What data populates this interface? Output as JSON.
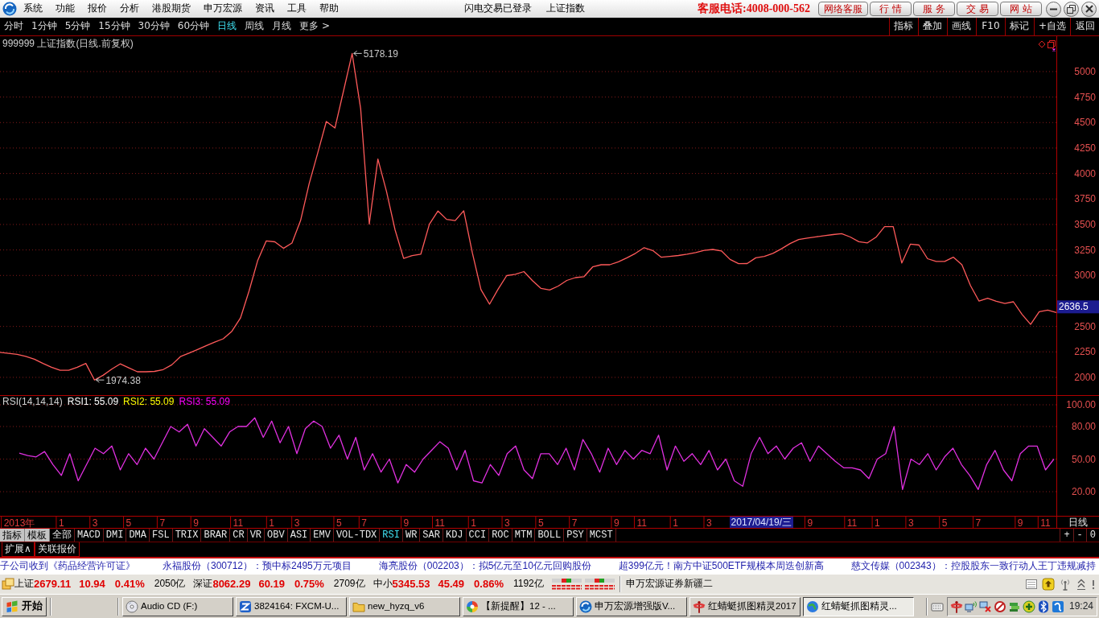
{
  "title_bar": {
    "menu": [
      "系统",
      "功能",
      "报价",
      "分析",
      "港股期货",
      "申万宏源",
      "资讯",
      "工具",
      "帮助"
    ],
    "login_status": "闪电交易已登录",
    "window_title": "上证指数",
    "hotline": "客服电话:4008-000-562",
    "service_buttons": [
      "网络客服",
      "行 情",
      "服 务",
      "交 易",
      "网 站"
    ]
  },
  "period_bar": {
    "periods": [
      {
        "label": "分时",
        "selected": false
      },
      {
        "label": "1分钟",
        "selected": false
      },
      {
        "label": "5分钟",
        "selected": false
      },
      {
        "label": "15分钟",
        "selected": false
      },
      {
        "label": "30分钟",
        "selected": false
      },
      {
        "label": "60分钟",
        "selected": false
      },
      {
        "label": "日线",
        "selected": true
      },
      {
        "label": "周线",
        "selected": false
      },
      {
        "label": "月线",
        "selected": false
      },
      {
        "label": "更多 >",
        "selected": false
      }
    ],
    "tools": [
      "指标",
      "叠加",
      "画线",
      "F10",
      "标记",
      "+自选",
      "返回"
    ]
  },
  "price_chart": {
    "chart_data": {
      "type": "line",
      "title": "999999 上证指数(日线.前复权)",
      "grid": true,
      "ylim": [
        1826,
        5347
      ],
      "yticks": [
        2000,
        2250,
        2500,
        3000,
        3250,
        3500,
        3750,
        4000,
        4250,
        4500,
        4750,
        5000
      ],
      "categories": [
        null,
        null,
        null,
        null,
        null,
        null,
        null,
        null,
        null,
        null,
        null,
        null,
        null,
        null,
        null,
        null,
        null,
        null,
        null,
        null,
        null,
        null,
        null,
        null,
        null,
        null,
        null,
        null,
        null,
        null,
        null,
        null,
        null,
        null,
        null,
        null,
        null,
        null,
        null,
        null,
        null,
        null,
        null,
        null,
        null,
        null,
        null,
        null,
        null,
        null,
        null,
        null,
        null,
        null,
        null,
        null,
        null,
        null,
        null,
        null,
        null,
        null,
        null,
        null,
        null,
        null,
        null,
        null,
        null,
        null,
        null,
        null,
        null,
        null,
        null,
        null,
        null,
        null,
        null,
        null,
        null,
        null,
        null,
        null,
        null,
        null,
        null,
        null,
        null,
        null,
        null,
        null,
        null,
        null,
        null,
        null,
        null,
        null,
        null,
        null,
        null,
        null,
        null,
        null,
        null,
        null,
        null,
        null,
        null,
        null,
        null,
        null,
        null,
        null,
        null,
        null,
        null,
        null,
        null,
        null,
        null,
        null,
        null,
        null
      ],
      "series": [
        {
          "color": "#ff5a5a",
          "values": [
            2245,
            2236,
            2226,
            2206,
            2179,
            2136,
            2099,
            2070,
            2070,
            2099,
            2137,
            1974.38,
            2020,
            2080,
            2132,
            2094,
            2055,
            2055,
            2059,
            2076,
            2123,
            2203,
            2237,
            2273,
            2310,
            2346,
            2379,
            2452,
            2582,
            2848,
            3144,
            3339,
            3330,
            3266,
            3318,
            3538,
            3901,
            4203,
            4510,
            4446,
            4810,
            5178.19,
            4635,
            3504,
            4142,
            3824,
            3448,
            3167,
            3195,
            3209,
            3503,
            3632,
            3550,
            3538,
            3635,
            3222,
            2862,
            2718,
            2865,
            2998,
            3011,
            3038,
            2949,
            2873,
            2857,
            2896,
            2951,
            2979,
            2988,
            3084,
            3105,
            3105,
            3134,
            3174,
            3217,
            3272,
            3245,
            3178,
            3186,
            3196,
            3209,
            3225,
            3246,
            3255,
            3241,
            3157,
            3115,
            3117,
            3173,
            3187,
            3216,
            3262,
            3313,
            3353,
            3366,
            3379,
            3391,
            3401,
            3410,
            3377,
            3331,
            3320,
            3375,
            3478,
            3478,
            3122,
            3307,
            3298,
            3164,
            3137,
            3137,
            3179,
            3106,
            2900,
            2748,
            2776,
            2747,
            2725,
            2742,
            2619,
            2520,
            2644,
            2660,
            2636.5
          ]
        }
      ],
      "annotations": [
        "5178.19",
        "1974.38",
        "2636.5"
      ]
    }
  },
  "rsi_panel": {
    "legend": [
      {
        "label": "RSI1: 55.09",
        "color": "#ffffff"
      },
      {
        "label": "RSI2: 55.09",
        "color": "#ffff00"
      },
      {
        "label": "RSI3: 55.09",
        "color": "#ff00ff"
      }
    ],
    "axis_period": "日线",
    "chart_data": {
      "type": "line",
      "title": "RSI(14,14,14)",
      "grid": true,
      "ylim": [
        -2.2,
        108.9
      ],
      "yticks": [
        {
          "value": 20,
          "label": "20.00"
        },
        {
          "value": 50,
          "label": "50.00"
        },
        {
          "value": 80,
          "label": "80.00"
        },
        {
          "value": 100,
          "label": "100.00"
        }
      ],
      "categories": [
        "2013年",
        null,
        null,
        null,
        null,
        "1",
        null,
        null,
        null,
        "3",
        null,
        null,
        null,
        "5",
        null,
        null,
        null,
        "7",
        null,
        null,
        null,
        "9",
        null,
        null,
        null,
        null,
        "11",
        null,
        null,
        null,
        "1",
        null,
        null,
        "3",
        null,
        null,
        null,
        null,
        "5",
        null,
        null,
        "7",
        null,
        null,
        null,
        null,
        "9",
        null,
        null,
        null,
        "11",
        null,
        null,
        null,
        "1",
        null,
        null,
        null,
        "3",
        null,
        null,
        null,
        "5",
        null,
        null,
        null,
        "7",
        null,
        null,
        null,
        null,
        "9",
        null,
        null,
        "11",
        null,
        null,
        null,
        "1",
        null,
        null,
        null,
        "3",
        null,
        null,
        null,
        null,
        null,
        null,
        null,
        null,
        null,
        null,
        null,
        "9",
        null,
        null,
        null,
        null,
        "11",
        null,
        null,
        "1",
        null,
        null,
        null,
        "3",
        null,
        null,
        null,
        "5",
        null,
        null,
        null,
        "7",
        null,
        null,
        null,
        null,
        "9",
        null,
        null,
        "11",
        null
      ],
      "series": [
        {
          "color": "#e030e0",
          "values": [
            55.4,
            53.2,
            52,
            57,
            45,
            35,
            55,
            30,
            45,
            60,
            55,
            62,
            40,
            55,
            45,
            60,
            50,
            65,
            80,
            75,
            82,
            62,
            78,
            70,
            62,
            75,
            80,
            80,
            88,
            70,
            85,
            65,
            80,
            55,
            78,
            85,
            80,
            60,
            72,
            50,
            70,
            40,
            55,
            38,
            50,
            28,
            45,
            38,
            50,
            58,
            66,
            60,
            40,
            58,
            30,
            28,
            45,
            35,
            55,
            62,
            40,
            32,
            55,
            55,
            45,
            60,
            40,
            68,
            55,
            38,
            60,
            45,
            58,
            50,
            58,
            55,
            72,
            40,
            62,
            48,
            55,
            45,
            58,
            40,
            50,
            30,
            25,
            55,
            70,
            55,
            62,
            50,
            60,
            65,
            48,
            62,
            55,
            48,
            42,
            42,
            40,
            32,
            50,
            55,
            80,
            22,
            50,
            45,
            55,
            40,
            52,
            60,
            45,
            35,
            22,
            45,
            58,
            40,
            30,
            55,
            62,
            62,
            40,
            50
          ]
        }
      ],
      "annotations": [
        "2017/04/19/三"
      ]
    }
  },
  "indicator_bar": {
    "buttons": [
      "指标",
      "模板"
    ],
    "tabs": [
      {
        "label": "全部",
        "selected": false
      },
      {
        "label": "MACD",
        "selected": false
      },
      {
        "label": "DMI",
        "selected": false
      },
      {
        "label": "DMA",
        "selected": false
      },
      {
        "label": "FSL",
        "selected": false
      },
      {
        "label": "TRIX",
        "selected": false
      },
      {
        "label": "BRAR",
        "selected": false
      },
      {
        "label": "CR",
        "selected": false
      },
      {
        "label": "VR",
        "selected": false
      },
      {
        "label": "OBV",
        "selected": false
      },
      {
        "label": "ASI",
        "selected": false
      },
      {
        "label": "EMV",
        "selected": false
      },
      {
        "label": "VOL-TDX",
        "selected": false
      },
      {
        "label": "RSI",
        "selected": true
      },
      {
        "label": "WR",
        "selected": false
      },
      {
        "label": "SAR",
        "selected": false
      },
      {
        "label": "KDJ",
        "selected": false
      },
      {
        "label": "CCI",
        "selected": false
      },
      {
        "label": "ROC",
        "selected": false
      },
      {
        "label": "MTM",
        "selected": false
      },
      {
        "label": "BOLL",
        "selected": false
      },
      {
        "label": "PSY",
        "selected": false
      },
      {
        "label": "MCST",
        "selected": false
      }
    ],
    "zoom_buttons": [
      "+",
      "-",
      "0"
    ]
  },
  "panel_tabs": [
    "扩展∧",
    "关联报价"
  ],
  "news_ticker": [
    "子公司收到《药品经营许可证》",
    "永福股份（300712）：预中标2495万元项目",
    "海亮股份（002203）：拟5亿元至10亿元回购股份",
    "超399亿元！南方中证500ETF规模本周迭创新高",
    "慈文传媒（002343）：控股股东一致行动人王丁违规减持"
  ],
  "status_bar": {
    "indices": [
      {
        "name": "上证",
        "value": "2679.11",
        "change": "10.94",
        "percent": "0.41%",
        "turnover": "2050亿",
        "color": "#e00000"
      },
      {
        "name": "深证",
        "value": "8062.29",
        "change": "60.19",
        "percent": "0.75%",
        "turnover": "2709亿",
        "color": "#e00000"
      },
      {
        "name": "中小",
        "value": "5345.53",
        "change": "45.49",
        "percent": "0.86%",
        "turnover": "1192亿",
        "color": "#e00000"
      }
    ],
    "broker": "申万宏源证券新疆二"
  },
  "taskbar": {
    "start": "开始",
    "windows": [
      {
        "label": "Audio CD (F:)",
        "active": false
      },
      {
        "label": "3824164: FXCM-U...",
        "active": false
      },
      {
        "label": "new_hyzq_v6",
        "active": false
      },
      {
        "label": "【新提醒】12 - ...",
        "active": false
      },
      {
        "label": "申万宏源增强版V...",
        "active": false
      },
      {
        "label": "红蜻蜓抓图精灵2017",
        "active": false
      },
      {
        "label": "红蜻蜓抓图精灵...",
        "active": true
      }
    ],
    "clock": "19:24"
  }
}
